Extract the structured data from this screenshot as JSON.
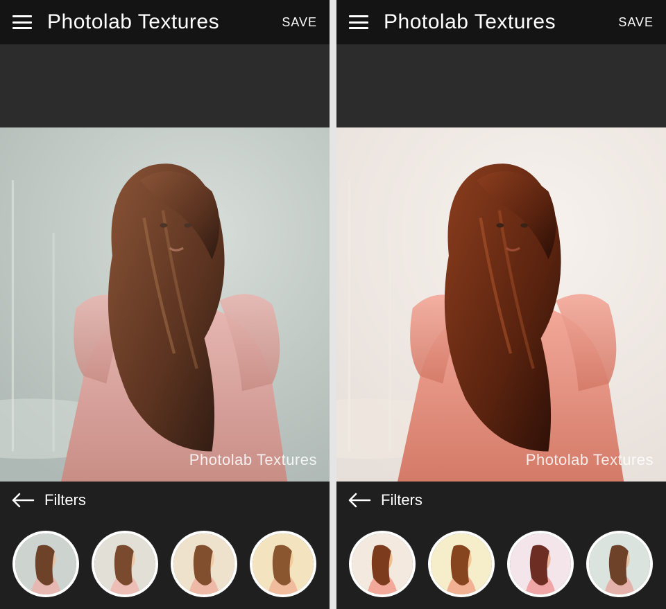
{
  "panels": [
    {
      "title": "Photolab Textures",
      "save": "SAVE",
      "filters_label": "Filters",
      "watermark": "Photolab Textures",
      "image_tone": "cool",
      "thumb_tones": [
        "cool",
        "soft",
        "warm",
        "gold"
      ]
    },
    {
      "title": "Photolab Textures",
      "save": "SAVE",
      "filters_label": "Filters",
      "watermark": "Photolab Textures",
      "image_tone": "warm",
      "thumb_tones": [
        "warm",
        "gold",
        "magenta",
        "desat"
      ]
    }
  ]
}
